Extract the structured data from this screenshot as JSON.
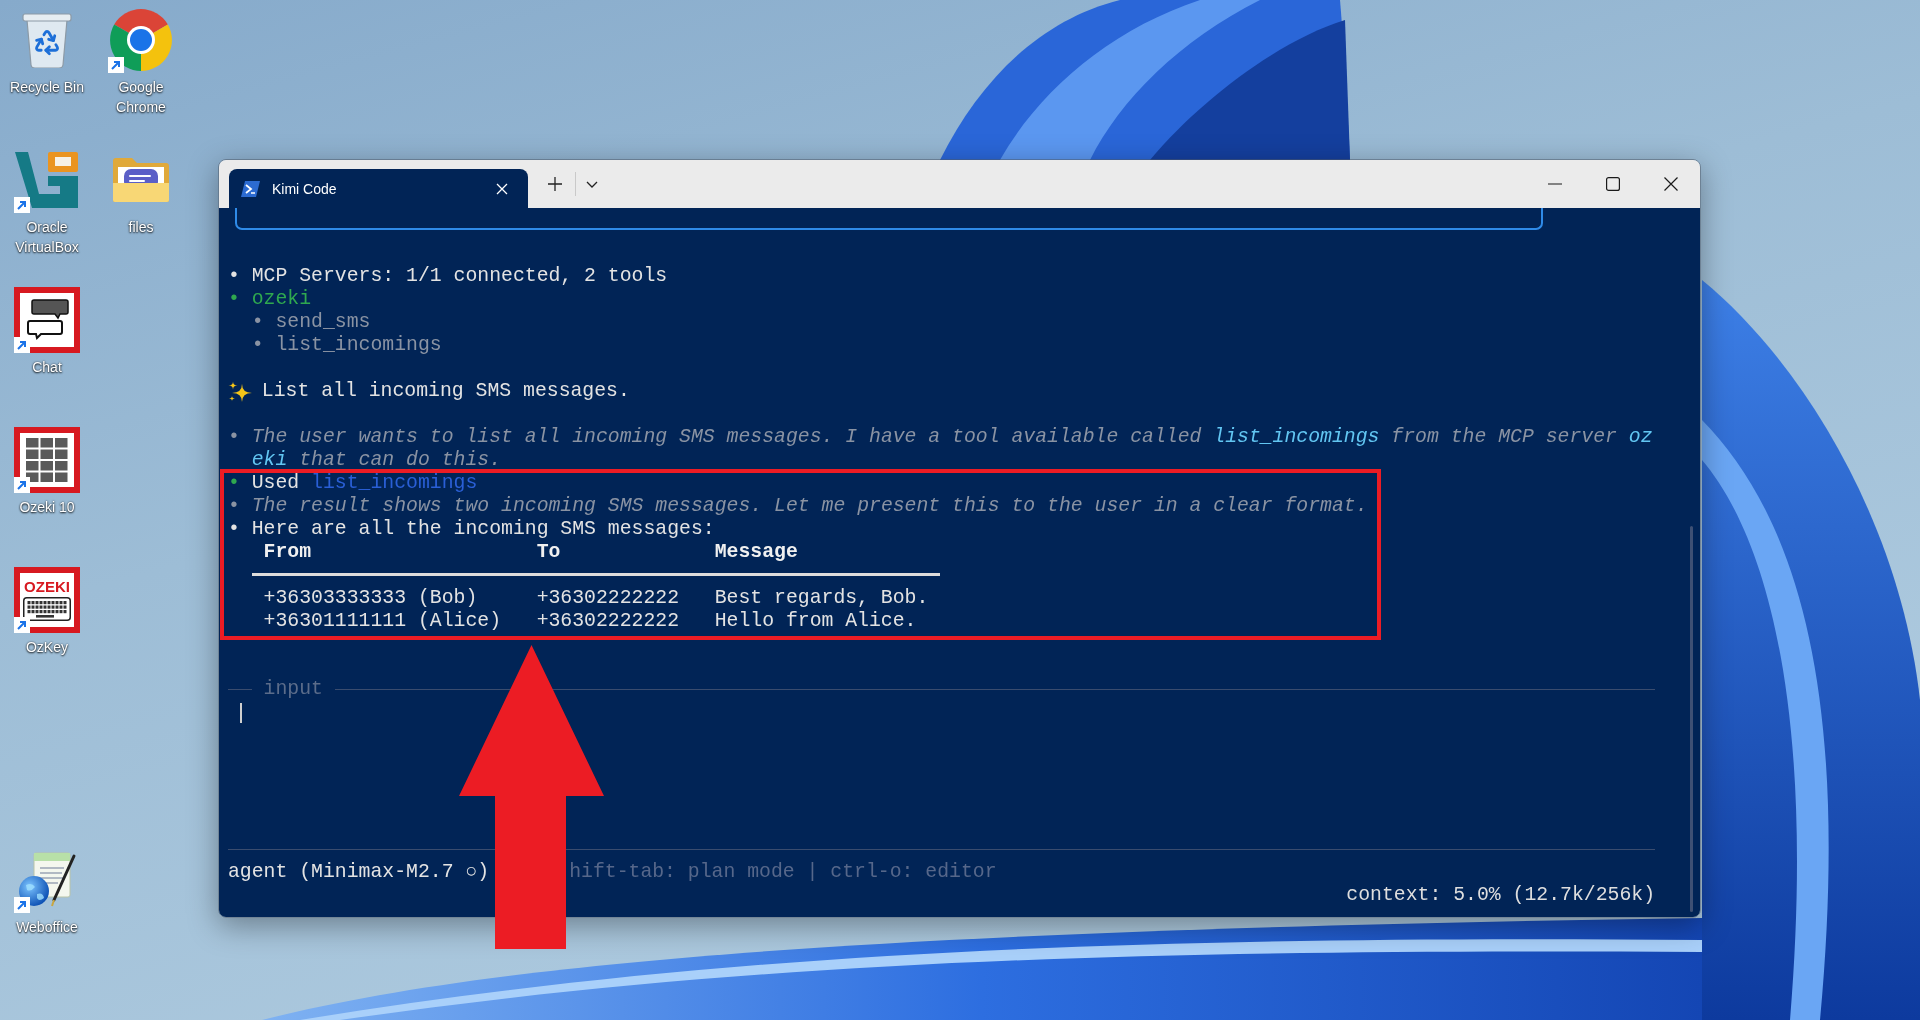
{
  "desktop": {
    "icons": [
      {
        "label": "Recycle Bin",
        "kind": "recycle_bin",
        "shortcut": false
      },
      {
        "label": "Google Chrome",
        "kind": "browser",
        "shortcut": true
      },
      {
        "label": "Oracle VirtualBox",
        "kind": "virtualbox",
        "shortcut": true
      },
      {
        "label": "files",
        "kind": "folder",
        "shortcut": false
      },
      {
        "label": "Chat",
        "kind": "chat",
        "shortcut": true
      },
      {
        "label": "Ozeki 10",
        "kind": "dialpad",
        "shortcut": true
      },
      {
        "label": "OzKey",
        "kind": "keyboard",
        "shortcut": true,
        "logo_text": "OZEKI"
      },
      {
        "label": "Weboffice",
        "kind": "weboffice",
        "shortcut": true
      }
    ]
  },
  "window": {
    "tabs": [
      {
        "title": "Kimi Code",
        "selected": true
      }
    ]
  },
  "terminal": {
    "transcript": [
      {
        "kind": "status",
        "bullet": "•",
        "text": "MCP Servers: 1/1 connected, 2 tools"
      },
      {
        "kind": "server",
        "bullet": "•",
        "text": "ozeki"
      },
      {
        "kind": "tool",
        "bullet": "•",
        "text": "send_sms"
      },
      {
        "kind": "tool",
        "bullet": "•",
        "text": "list_incomings"
      },
      {
        "kind": "prompt",
        "text": "List all incoming SMS messages."
      },
      {
        "kind": "thinking",
        "bullet": "•",
        "segments": [
          {
            "kind": "plain",
            "text": "The user wants to list all incoming SMS messages. I have a tool available called "
          },
          {
            "kind": "code",
            "text": "list_incomings"
          },
          {
            "kind": "plain",
            "text": " from the MCP server "
          },
          {
            "kind": "code",
            "text": "ozeki"
          },
          {
            "kind": "plain",
            "text": " that can do this."
          }
        ]
      },
      {
        "kind": "tool_call",
        "bullet": "•",
        "label": "Used",
        "tool": "list_incomings"
      },
      {
        "kind": "thinking",
        "bullet": "•",
        "segments": [
          {
            "kind": "plain",
            "text": "The result shows two incoming SMS messages. Let me present this to the user in a clear format."
          }
        ]
      },
      {
        "kind": "answer",
        "bullet": "•",
        "text": "Here are all the incoming SMS messages:",
        "table": {
          "columns": [
            "From",
            "To",
            "Message"
          ],
          "rows": [
            [
              "+36303333333 (Bob)",
              "+36302222222",
              "Best regards, Bob."
            ],
            [
              "+36301111111 (Alice)",
              "+36302222222",
              "Hello from Alice."
            ]
          ]
        }
      }
    ],
    "input_box": {
      "label": "input"
    },
    "status_bar": {
      "mode": "agent (Minimax-M2.7 ○)",
      "hints": "hift-tab: plan mode | ctrl-o: editor",
      "context": "context: 5.0% (12.7k/256k)"
    }
  }
}
